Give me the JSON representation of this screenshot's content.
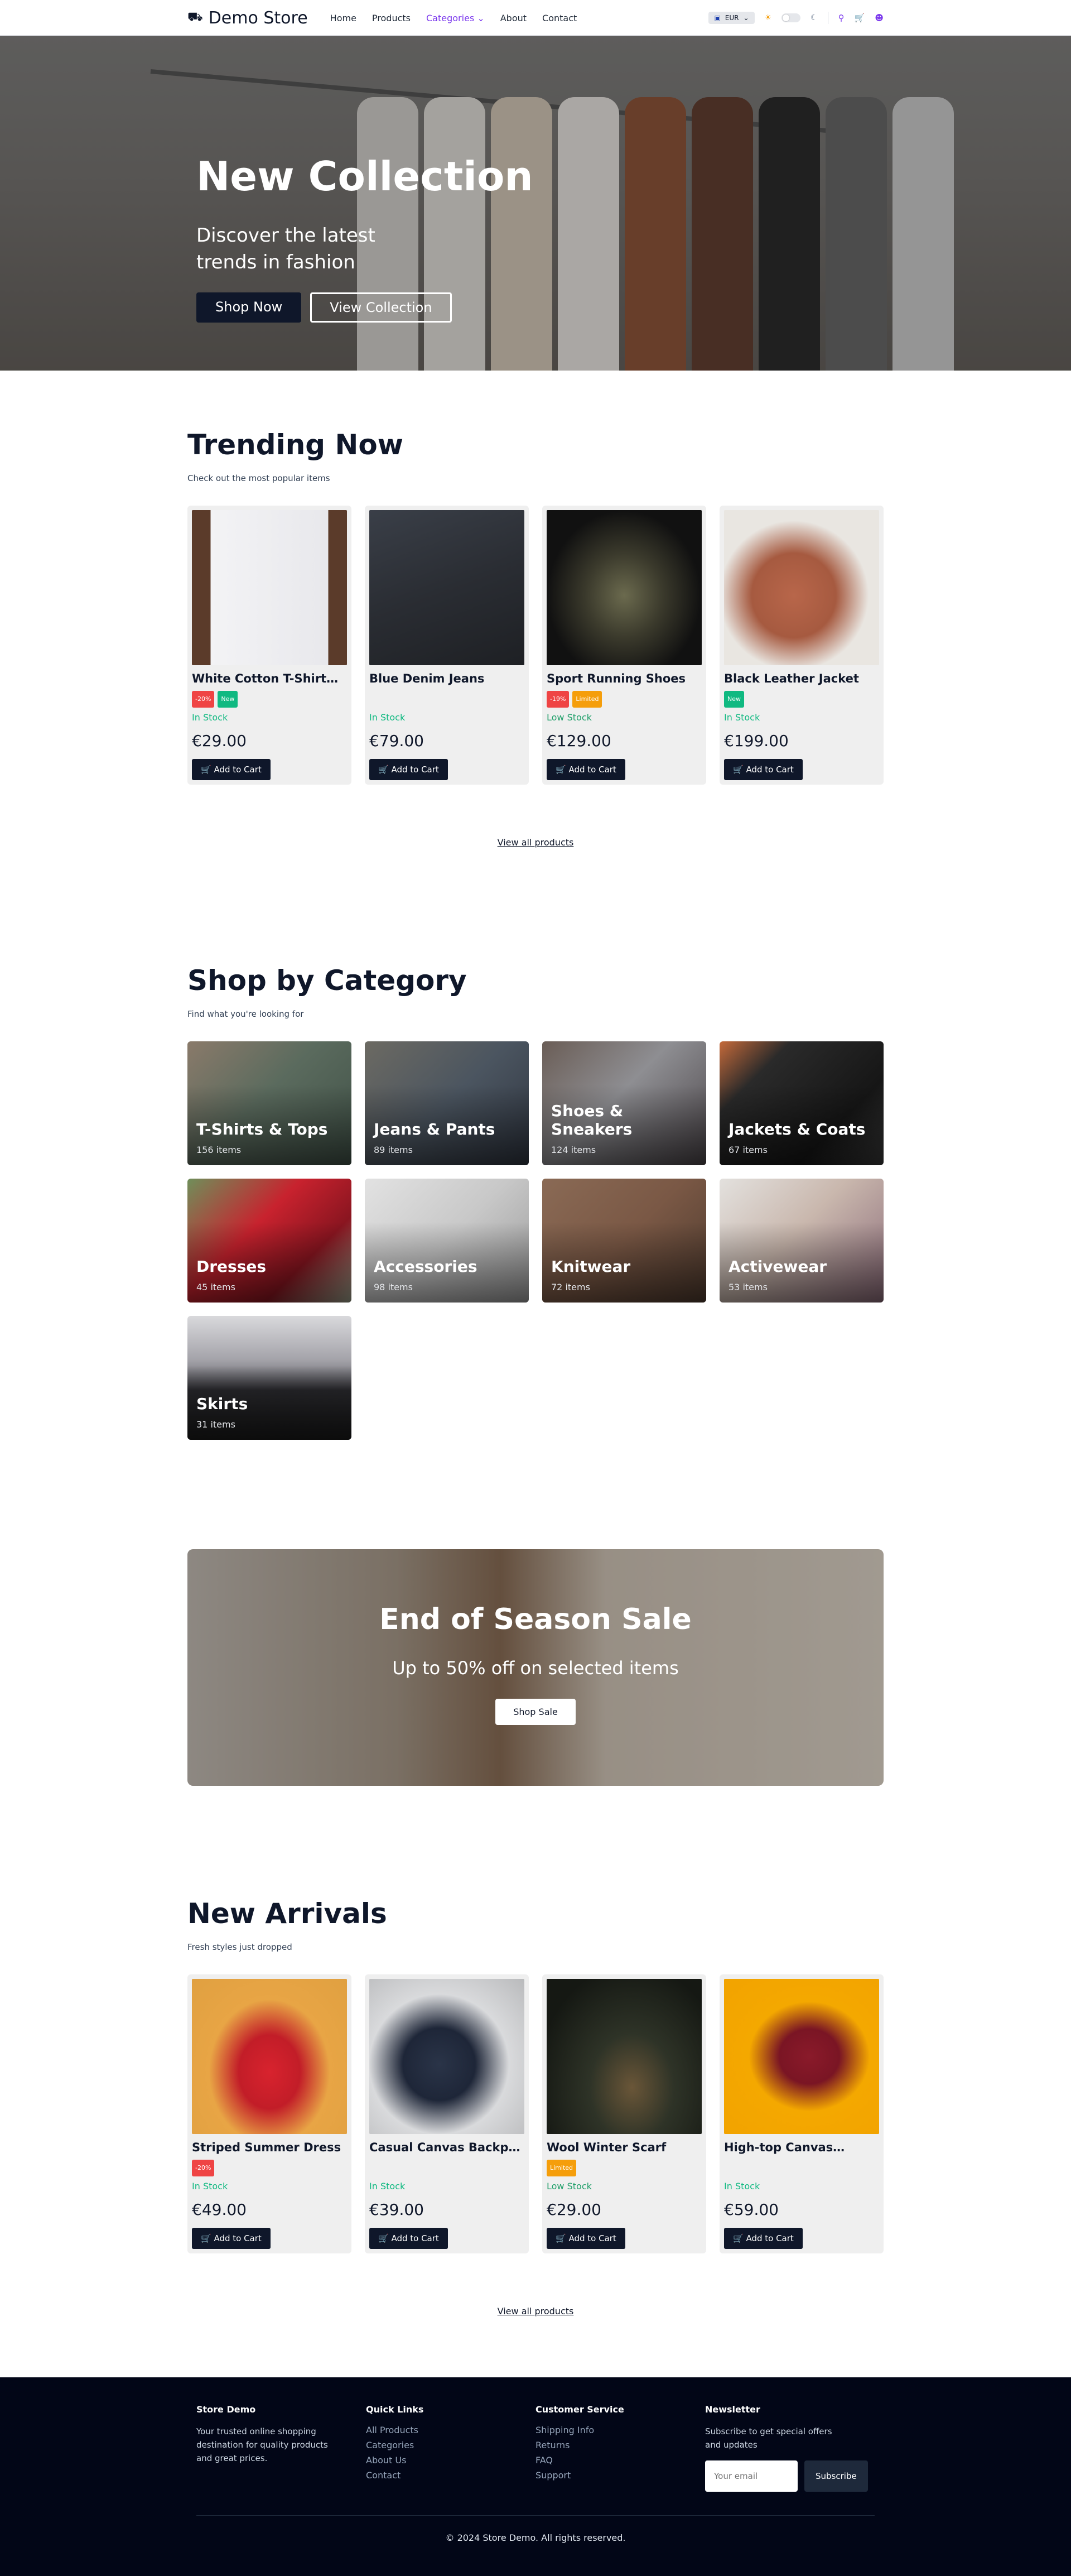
{
  "header": {
    "logo": "Demo Store",
    "logo_icon": "store-icon",
    "nav": [
      {
        "label": "Home"
      },
      {
        "label": "Products"
      },
      {
        "label": "Categories ⌄"
      },
      {
        "label": "About"
      },
      {
        "label": "Contact"
      }
    ],
    "currency": "EUR",
    "accent_color": "#7c3aed"
  },
  "hero": {
    "title": "New Collection",
    "subtitle": "Discover the latest trends in fashion",
    "primary_button": "Shop Now",
    "secondary_button": "View Collection"
  },
  "trending": {
    "title": "Trending Now",
    "subtitle": "Check out the most popular items",
    "products": [
      {
        "name": "White Cotton T-Shirt…",
        "badges": [
          "-20%",
          "New"
        ],
        "stock": "In Stock",
        "price": "€29.00",
        "button": "Add to Cart"
      },
      {
        "name": "Blue Denim Jeans",
        "badges": [],
        "stock": "In Stock",
        "price": "€79.00",
        "button": "Add to Cart"
      },
      {
        "name": "Sport Running Shoes",
        "badges": [
          "-19%",
          "Limited"
        ],
        "stock": "Low Stock",
        "price": "€129.00",
        "button": "Add to Cart"
      },
      {
        "name": "Black Leather Jacket",
        "badges": [
          "New"
        ],
        "stock": "In Stock",
        "price": "€199.00",
        "button": "Add to Cart"
      }
    ],
    "view_all": "View all products"
  },
  "categories": {
    "title": "Shop by Category",
    "subtitle": "Find what you're looking for",
    "items": [
      {
        "name": "T-Shirts & Tops",
        "count": "156 items"
      },
      {
        "name": "Jeans & Pants",
        "count": "89 items"
      },
      {
        "name": "Shoes & Sneakers",
        "count": "124 items"
      },
      {
        "name": "Jackets & Coats",
        "count": "67 items"
      },
      {
        "name": "Dresses",
        "count": "45 items"
      },
      {
        "name": "Accessories",
        "count": "98 items"
      },
      {
        "name": "Knitwear",
        "count": "72 items"
      },
      {
        "name": "Activewear",
        "count": "53 items"
      },
      {
        "name": "Skirts",
        "count": "31 items"
      }
    ]
  },
  "sale_banner": {
    "title": "End of Season Sale",
    "subtitle": "Up to 50% off on selected items",
    "button": "Shop Sale"
  },
  "new_arrivals": {
    "title": "New Arrivals",
    "subtitle": "Fresh styles just dropped",
    "products": [
      {
        "name": "Striped Summer Dress",
        "badges": [
          "-20%"
        ],
        "stock": "In Stock",
        "price": "€49.00",
        "button": "Add to Cart"
      },
      {
        "name": "Casual Canvas Backpack",
        "badges": [],
        "stock": "In Stock",
        "price": "€39.00",
        "button": "Add to Cart"
      },
      {
        "name": "Wool Winter Scarf",
        "badges": [
          "Limited"
        ],
        "stock": "Low Stock",
        "price": "€29.00",
        "button": "Add to Cart"
      },
      {
        "name": "High-top Canvas…",
        "badges": [],
        "stock": "In Stock",
        "price": "€59.00",
        "button": "Add to Cart"
      }
    ],
    "view_all": "View all products"
  },
  "footer": {
    "about_title": "Store Demo",
    "about_text": "Your trusted online shopping destination for quality products and great prices.",
    "quick_links_title": "Quick Links",
    "quick_links": [
      "All Products",
      "Categories",
      "About Us",
      "Contact"
    ],
    "service_title": "Customer Service",
    "service_links": [
      "Shipping Info",
      "Returns",
      "FAQ",
      "Support"
    ],
    "newsletter_title": "Newsletter",
    "newsletter_text": "Subscribe to get special offers and updates",
    "email_placeholder": "Your email",
    "subscribe_button": "Subscribe",
    "copyright": "© 2024 Store Demo. All rights reserved."
  }
}
